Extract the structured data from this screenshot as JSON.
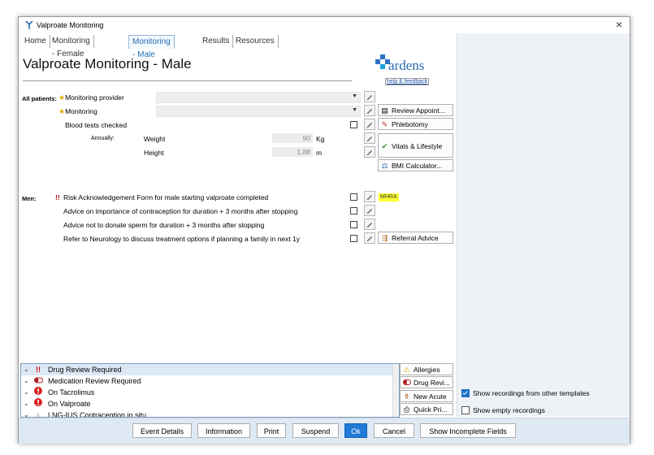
{
  "window": {
    "title": "Valproate Monitoring",
    "close_glyph": "×"
  },
  "tabs": [
    {
      "label": "Home"
    },
    {
      "label": "Monitoring - Female"
    },
    {
      "label": "Monitoring - Male"
    },
    {
      "label": "Results"
    },
    {
      "label": "Resources"
    }
  ],
  "active_tab": "Monitoring - Male",
  "page_title": "Valproate Monitoring - Male",
  "logo": {
    "text": "ardens",
    "link": "help & feedback"
  },
  "sections": {
    "all_patients_label": "All patients:",
    "men_label": "Men:"
  },
  "fields": {
    "monitoring_provider": "Monitoring provider",
    "monitoring": "Monitoring",
    "blood_tests": "Blood tests checked",
    "annually": "Annually:",
    "weight": {
      "label": "Weight",
      "value": "90",
      "unit": "Kg"
    },
    "height": {
      "label": "Height",
      "value": "1.88",
      "unit": "m"
    }
  },
  "men_items": [
    {
      "prefix": "!!",
      "text": "Risk Acknowledgement Form for male starting valproate completed"
    },
    {
      "prefix": "",
      "text": "Advice on importance of contraception for duration + 3 months after stopping"
    },
    {
      "prefix": "",
      "text": "Advice not to donate sperm for duration + 3 months after stopping"
    },
    {
      "prefix": "",
      "text": "Refer to Neurology to discuss treatment options if planning a family in next 1y"
    }
  ],
  "side_buttons": {
    "review": "Review Appoint...",
    "phlebotomy": "Phlebotomy",
    "vitals": "Vitals & Lifestyle",
    "bmi": "BMI Calculator...",
    "mhra": "MHRA",
    "referral": "Referral Advice"
  },
  "alerts": [
    {
      "icon": "!!",
      "text": "Drug Review Required"
    },
    {
      "icon": "pill",
      "text": "Medication Review Required"
    },
    {
      "icon": "!",
      "text": "On Tacrolimus"
    },
    {
      "icon": "!",
      "text": "On Valproate"
    },
    {
      "icon": "female",
      "text": "LNG-IUS Contraception in situ"
    }
  ],
  "alert_buttons": {
    "allergies": "Allergies",
    "drug_review": "Drug Revi...",
    "new_acute": "New Acute",
    "quick_pri": "Quick Pri..."
  },
  "right_panel": {
    "show_other": {
      "label": "Show recordings from other templates",
      "checked": true
    },
    "show_empty": {
      "label": "Show empty recordings",
      "checked": false
    }
  },
  "footer": {
    "event_details": "Event Details",
    "information": "Information",
    "print": "Print",
    "suspend": "Suspend",
    "ok": "Ok",
    "cancel": "Cancel",
    "show_incomplete": "Show Incomplete Fields"
  },
  "colors": {
    "accent": "#1e7ad4",
    "warning": "#cc0000",
    "highlight": "#ffff33",
    "tab_active": "#1f6fb2"
  }
}
